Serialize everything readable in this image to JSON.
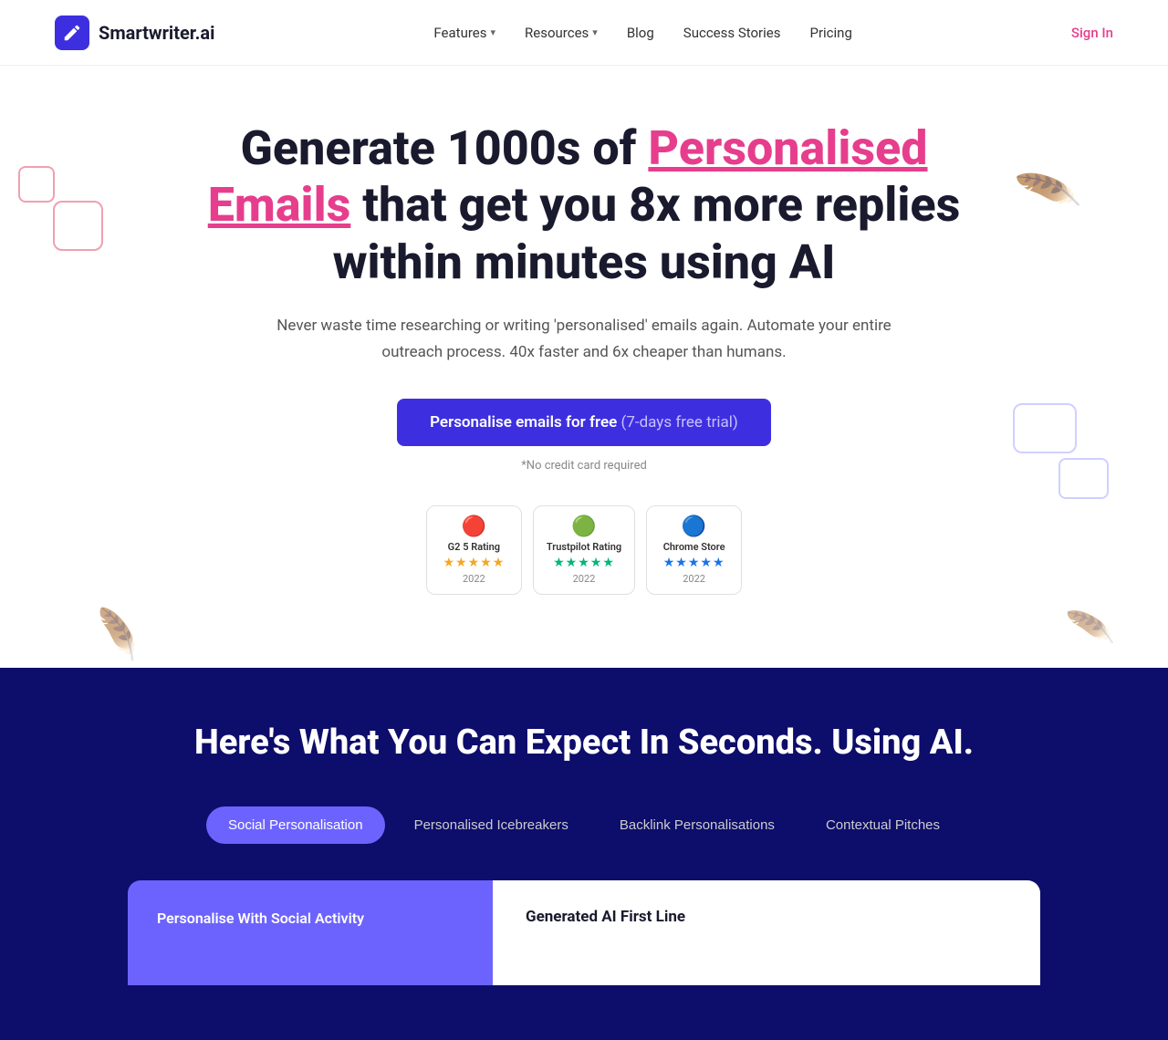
{
  "nav": {
    "logo_text": "Smartwriter.ai",
    "links": [
      {
        "label": "Features",
        "has_dropdown": true
      },
      {
        "label": "Resources",
        "has_dropdown": true
      },
      {
        "label": "Blog",
        "has_dropdown": false
      },
      {
        "label": "Success Stories",
        "has_dropdown": false
      },
      {
        "label": "Pricing",
        "has_dropdown": false
      }
    ],
    "signin_label": "Sign In"
  },
  "hero": {
    "headline_part1": "Generate 1000s of ",
    "headline_highlight": "Personalised Emails",
    "headline_part2": " that get you 8x more replies within minutes using AI",
    "subtext": "Never waste time researching or writing 'personalised' emails again. Automate your entire outreach process. 40x faster and 6x cheaper than humans.",
    "cta_label": "Personalise emails for free",
    "cta_trial": "(7-days free trial)",
    "no_cc": "*No credit card required",
    "badges": [
      {
        "icon": "🔴",
        "title": "G2 5 Rating",
        "stars": "★★★★★",
        "star_class": "red",
        "year": "2022"
      },
      {
        "icon": "🟢",
        "title": "Trustpilot Rating",
        "stars": "★★★★★",
        "star_class": "green",
        "year": "2022"
      },
      {
        "icon": "🔵",
        "title": "Chrome Store",
        "stars": "★★★★★",
        "star_class": "blue",
        "year": "2022"
      }
    ]
  },
  "dark_section": {
    "heading": "Here's What You Can Expect In Seconds. Using AI.",
    "tabs": [
      {
        "label": "Social Personalisation",
        "active": true
      },
      {
        "label": "Personalised Icebreakers",
        "active": false
      },
      {
        "label": "Backlink Personalisations",
        "active": false
      },
      {
        "label": "Contextual Pitches",
        "active": false
      }
    ],
    "panel_left_label": "Personalise With Social Activity",
    "panel_right_title": "Generated AI First Line"
  }
}
